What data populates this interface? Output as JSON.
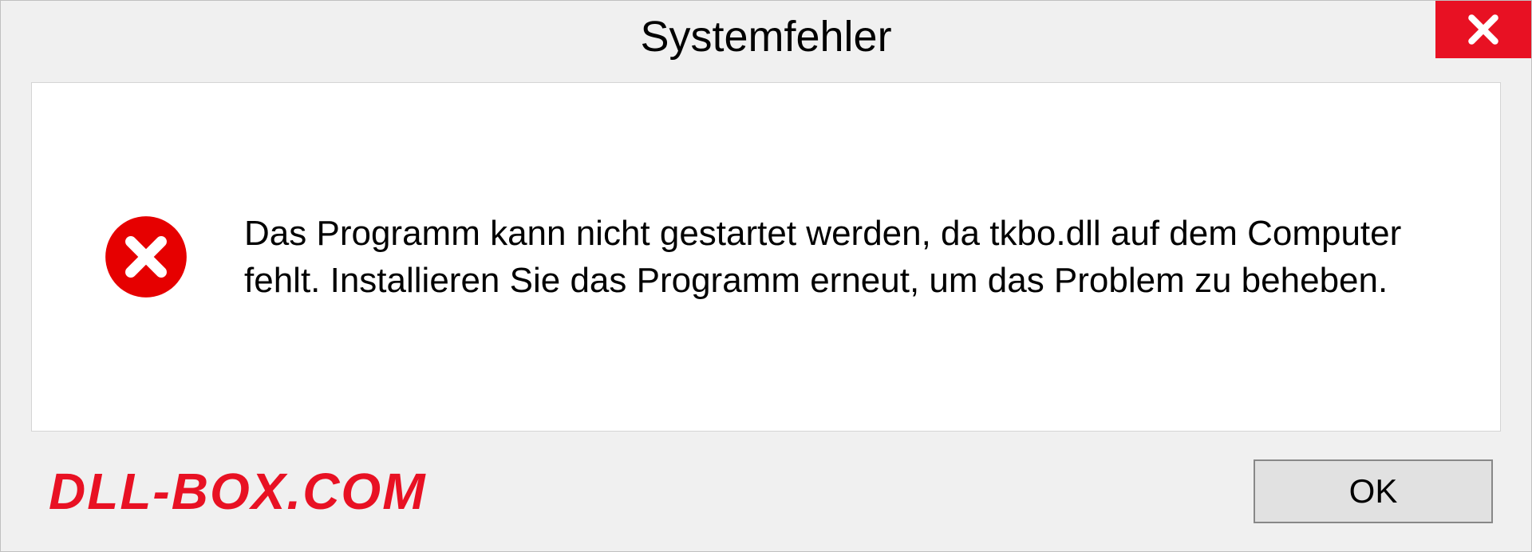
{
  "dialog": {
    "title": "Systemfehler",
    "message": "Das Programm kann nicht gestartet werden, da tkbo.dll auf dem Computer fehlt. Installieren Sie das Programm erneut, um das Problem zu beheben.",
    "ok_label": "OK"
  },
  "watermark": "DLL-BOX.COM",
  "icons": {
    "close": "close-icon",
    "error": "error-circle-x-icon"
  },
  "colors": {
    "close_button_bg": "#e81123",
    "error_icon_fill": "#e60000",
    "watermark_color": "#e81123"
  }
}
